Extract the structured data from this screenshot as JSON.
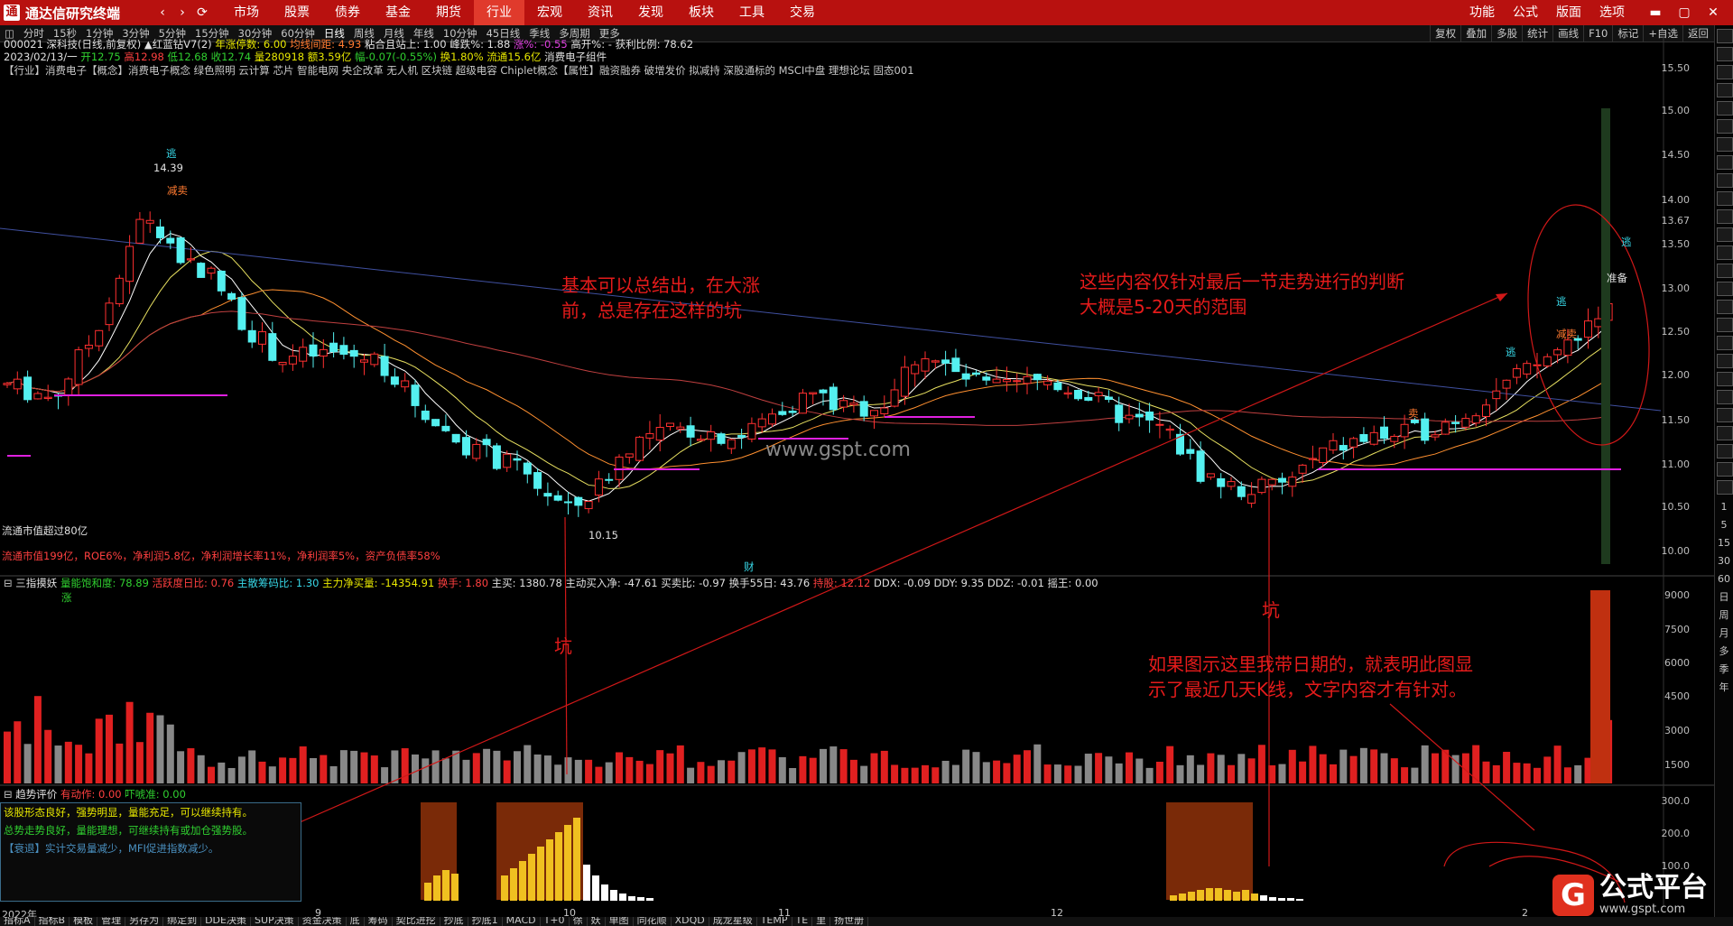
{
  "titlebar": {
    "logo_glyph": "通",
    "title": "通达信研究终端",
    "menus": [
      "市场",
      "股票",
      "债券",
      "基金",
      "期货",
      "行业",
      "宏观",
      "资讯",
      "发现",
      "板块",
      "工具",
      "交易"
    ],
    "active_menu": "行业",
    "right_menus": [
      "功能",
      "公式",
      "版面",
      "选项"
    ],
    "window_controls": [
      "▬",
      "▢",
      "✕"
    ]
  },
  "periods": [
    "分时",
    "15秒",
    "1分钟",
    "3分钟",
    "5分钟",
    "15分钟",
    "30分钟",
    "60分钟",
    "日线",
    "周线",
    "月线",
    "年线",
    "10分钟",
    "45日线",
    "季线",
    "多周期",
    "更多"
  ],
  "toolbar_right": [
    "复权",
    "叠加",
    "多股",
    "统计",
    "画线",
    "F10",
    "标记",
    "+自选",
    "返回"
  ],
  "stock_info": {
    "line1_code": "000021 深科技(日线,前复权)",
    "line1_indicator": "▲红蓝钻V7(2)",
    "line1_a": "年涨停数: 6.00",
    "line1_b": "均线间距: 4.93",
    "line1_c": "粘合且站上: 1.00",
    "line1_d": "峰跌%: 1.88",
    "line1_e": "涨%: -0.55",
    "line1_f": "高开%: -",
    "line1_g": "获利比例: 78.62",
    "line2_date": "2023/02/13/一",
    "line2_open": "开12.75",
    "line2_high": "高12.98",
    "line2_low": "低12.68",
    "line2_close": "收12.74",
    "line2_vol": "量280918",
    "line2_amt": "额3.59亿",
    "line2_chg": "幅-0.07(-0.55%)",
    "line2_turn": "换1.80%",
    "line2_float": "流通15.6亿",
    "line2_sector": "消费电子组件",
    "line3": "【行业】消费电子【概念】消费电子概念 绿色照明 云计算 芯片 智能电网 央企改革 无人机 区块链 超级电容 Chiplet概念【属性】融资融券 破增发价 拟减持 深股通标的 MSCI中盘 理想论坛 固态001"
  },
  "chart_labels": {
    "high_mark": "14.39",
    "low_mark": "10.15",
    "flee1": "逃",
    "reduce1": "减卖",
    "flee2": "逃",
    "reduce2": "减卖",
    "flee3": "逃",
    "prepare": "准备",
    "flee4": "逃",
    "sell_small": "卖",
    "cap_note": "流通市值超过80亿",
    "fundamental": "流通市值199亿，ROE6%，净利润5.8亿，净利润增长率11%，净利润率5%，资产负债率58%",
    "cai": "财",
    "zhang": "涨"
  },
  "price_axis": [
    "15.50",
    "15.00",
    "14.50",
    "14.00",
    "13.67",
    "13.50",
    "13.00",
    "12.50",
    "12.00",
    "11.50",
    "11.00",
    "10.50",
    "10.00"
  ],
  "volume_panel": {
    "title": "三指摸妖",
    "a": "量能饱和度: 78.89",
    "b": "活跃度日比: 0.76",
    "c": "主散筹码比: 1.30",
    "d": "主力净买量: -14354.91",
    "e": "换手: 1.80",
    "f": "主买: 1380.78",
    "g": "主动买入净: -47.61",
    "h": "买卖比: -0.97",
    "i": "换手55日: 43.76",
    "j": "持股: 12.12",
    "k": "DDX: -0.09",
    "l": "DDY: 9.35",
    "m": "DDZ: -0.01",
    "n": "摇王: 0.00",
    "axis": [
      "9000",
      "7500",
      "6000",
      "4500",
      "3000",
      "1500"
    ]
  },
  "trend_panel": {
    "title": "趋势评价",
    "a": "有动作: 0.00",
    "b": "吓唬准: 0.00",
    "axis": [
      "300.0",
      "200.0",
      "100.0"
    ],
    "eval1": "该股形态良好，强势明显，量能充足，可以继续持有。",
    "eval2": "总势走势良好，量能理想，可继续持有或加仓强势股。",
    "eval3": "【衰退】实计交易量减少，MFI促进指数减少。"
  },
  "date_axis": [
    "2022年",
    "9",
    "10",
    "11",
    "12",
    "2"
  ],
  "annotations": {
    "a1_l1": "基本可以总结出，在大涨",
    "a1_l2": "前，总是存在这样的坑",
    "a2_l1": "这些内容仅针对最后一节走势进行的判断",
    "a2_l2": "大概是5-20天的范围",
    "keng1": "坑",
    "keng2": "坑",
    "a3_l1": "如果图示这里我带日期的，就表明此图显",
    "a3_l2": "示了最近几天K线，文字内容才有针对。"
  },
  "watermark": "www.gspt.com",
  "brand": {
    "logo": "G",
    "name": "公式平台",
    "url": "www.gspt.com"
  },
  "bottom_tabs": [
    "指标A",
    "指标B",
    "模板",
    "管理",
    "另存为",
    "绑定到",
    "DDE决策",
    "SUP决策",
    "资金决策",
    "底",
    "筹码",
    "契比进挖",
    "抄底",
    "抄底1",
    "MACD",
    "T+0",
    "徐",
    "妖",
    "单图",
    "同花顺",
    "XDQD",
    "成龙星级",
    "TEMP",
    "TE",
    "里",
    "扬世册"
  ],
  "side_timeframes": [
    "1",
    "5",
    "15",
    "30",
    "60",
    "日",
    "周",
    "月",
    "多",
    "季",
    "年"
  ],
  "colors": {
    "up": "#ff3030",
    "down": "#54f0f0",
    "accent": "#b8110f",
    "annotation": "#e51b1b"
  }
}
